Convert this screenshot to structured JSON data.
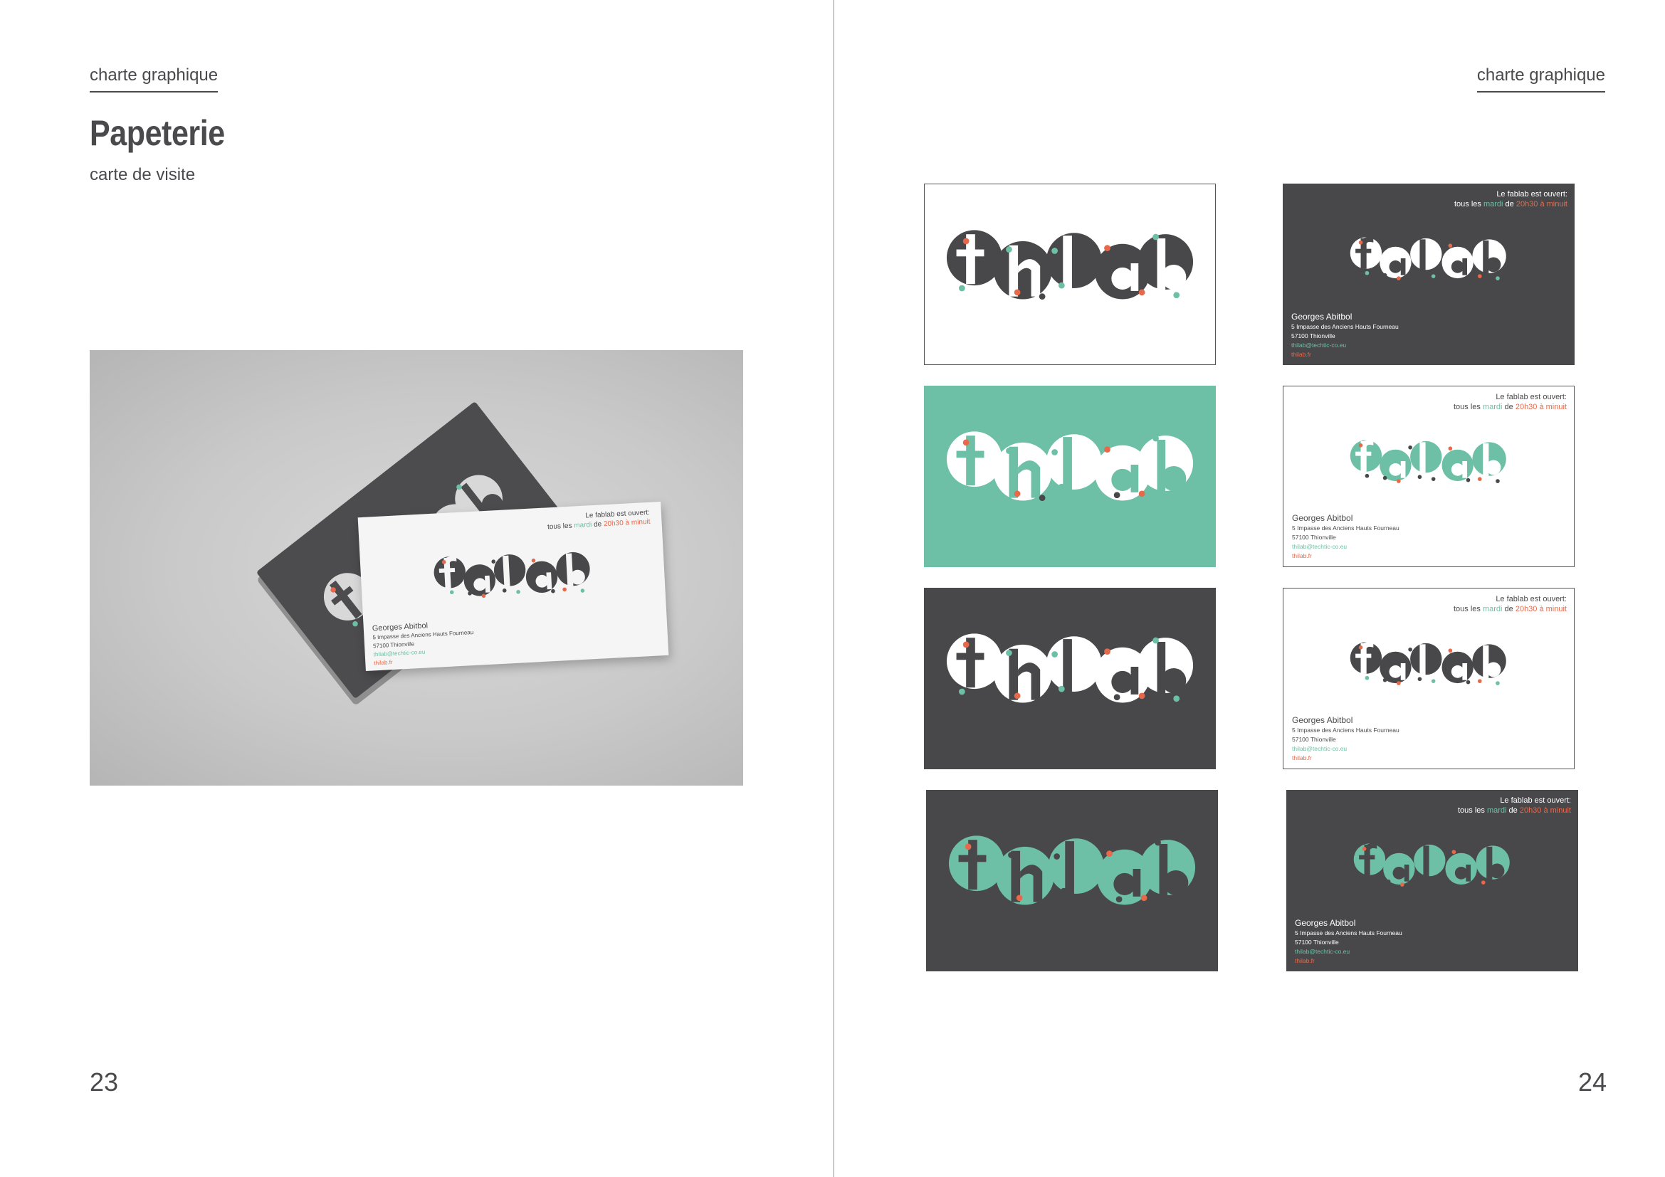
{
  "left_page": {
    "section_label": "charte graphique",
    "title": "Papeterie",
    "subtitle": "carte de visite",
    "page_number": "23"
  },
  "right_page": {
    "section_label": "charte graphique",
    "page_number": "24"
  },
  "card_info": {
    "open_line": "Le fablab est ouvert:",
    "schedule_prefix": "tous les ",
    "schedule_day": "mardi",
    "schedule_mid": " de ",
    "schedule_time": "20h30 à minuit",
    "contact_name": "Georges Abitbol",
    "address_line1": "5 Impasse des Anciens Hauts Fourneau",
    "address_line2": "57100 Thionville",
    "email": "thilab@techtic-co.eu",
    "website": "thilab.fr"
  },
  "colors": {
    "dark_gray": "#48484b",
    "mint_green": "#6dc0a6",
    "orange": "#e8694a",
    "white": "#ffffff"
  },
  "photo": {
    "description_icon": "business-card-mockup"
  },
  "cards": [
    {
      "side": "recto",
      "background": "white",
      "logo_color": "#48484b",
      "outlined": true
    },
    {
      "side": "verso",
      "background": "dark",
      "logo_color": "#ffffff"
    },
    {
      "side": "recto",
      "background": "green",
      "logo_color": "#ffffff"
    },
    {
      "side": "verso",
      "background": "white",
      "logo_color": "#6dc0a6"
    },
    {
      "side": "recto",
      "background": "dark",
      "logo_color": "#ffffff"
    },
    {
      "side": "verso",
      "background": "white",
      "logo_color": "#48484b"
    },
    {
      "side": "recto",
      "background": "dark",
      "logo_color": "#6dc0a6"
    },
    {
      "side": "verso",
      "background": "dark",
      "logo_color": "#6dc0a6"
    }
  ]
}
